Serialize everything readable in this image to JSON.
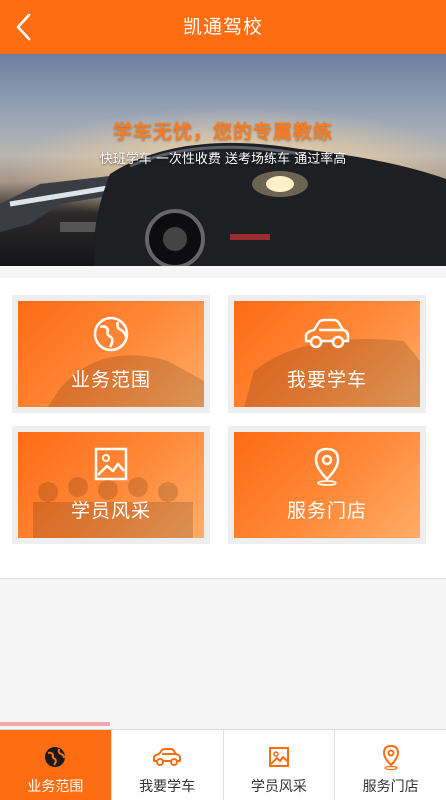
{
  "header": {
    "title": "凯通驾校"
  },
  "banner": {
    "headline": "学车无忧，您的专属教练",
    "subline": "快班学车 一次性收费 送考场练车 通过率高"
  },
  "tiles": [
    {
      "label": "业务范围",
      "icon": "globe-icon"
    },
    {
      "label": "我要学车",
      "icon": "car-icon"
    },
    {
      "label": "学员风采",
      "icon": "image-icon"
    },
    {
      "label": "服务门店",
      "icon": "location-pin-icon"
    }
  ],
  "tabbar": {
    "active_index": 0,
    "items": [
      {
        "label": "业务范围",
        "icon": "globe-icon"
      },
      {
        "label": "我要学车",
        "icon": "car-icon"
      },
      {
        "label": "学员风采",
        "icon": "image-icon"
      },
      {
        "label": "服务门店",
        "icon": "location-pin-icon"
      }
    ]
  },
  "colors": {
    "accent": "#ff6d12",
    "inactive_icon": "#ff6d12",
    "text": "#333333"
  }
}
